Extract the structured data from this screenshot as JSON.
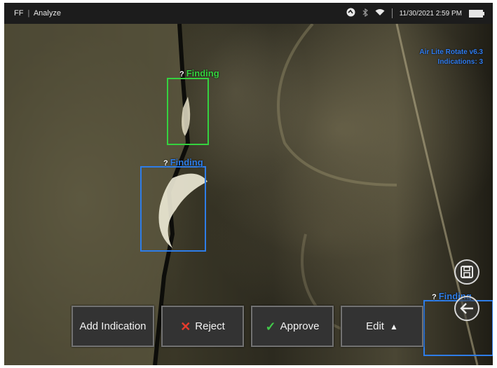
{
  "statusbar": {
    "app": "FF",
    "separator": "|",
    "screen": "Analyze",
    "datetime": "11/30/2021 2:59 PM",
    "icons": [
      "analytics-icon",
      "bluetooth-icon",
      "wifi-icon",
      "battery-icon"
    ]
  },
  "overlay": {
    "model": "Air Lite Rotate v6.3",
    "indications": "Indications: 3"
  },
  "findings": [
    {
      "marker": "?",
      "label": "Finding",
      "color": "#35d23f"
    },
    {
      "marker": "?",
      "label": "Finding",
      "color": "#2e7de8"
    },
    {
      "marker": "?",
      "label": "Finding",
      "color": "#2e7de8"
    }
  ],
  "side_buttons": [
    "save-icon",
    "back-arrow-icon"
  ],
  "toolbar": {
    "add_indication": "Add Indication",
    "reject": "Reject",
    "approve": "Approve",
    "edit": "Edit"
  },
  "colors": {
    "accent_blue": "#2e7de8",
    "accent_green": "#35d23f",
    "reject_red": "#e53b2c",
    "approve_green": "#42c94a"
  }
}
